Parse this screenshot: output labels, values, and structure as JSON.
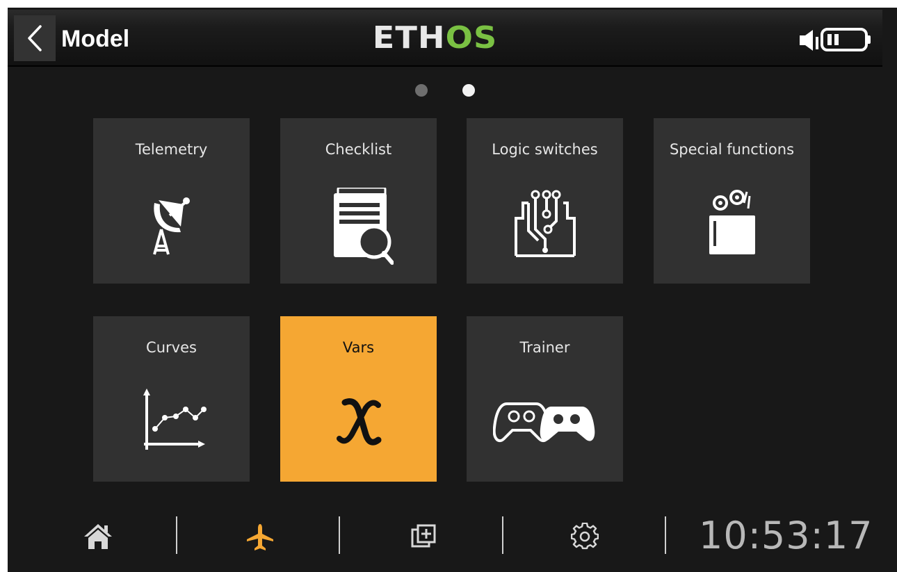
{
  "header": {
    "title": "Model",
    "brand": {
      "part1": "ETH",
      "part2": "OS"
    }
  },
  "pager": {
    "pages": 2,
    "current": 2
  },
  "tiles": [
    {
      "label": "Telemetry",
      "icon": "satellite-dish-icon",
      "selected": false
    },
    {
      "label": "Checklist",
      "icon": "checklist-search-icon",
      "selected": false
    },
    {
      "label": "Logic switches",
      "icon": "logic-circuit-icon",
      "selected": false
    },
    {
      "label": "Special functions",
      "icon": "gears-box-icon",
      "selected": false
    },
    {
      "label": "Curves",
      "icon": "line-graph-icon",
      "selected": false
    },
    {
      "label": "Vars",
      "icon": "variable-x-icon",
      "selected": true
    },
    {
      "label": "Trainer",
      "icon": "gamepads-icon",
      "selected": false
    }
  ],
  "bottom_nav": {
    "items": [
      "home-icon",
      "airplane-icon",
      "layers-add-icon",
      "gear-icon"
    ],
    "active": "airplane-icon",
    "clock": "10:53:17"
  },
  "colors": {
    "accent": "#f5a733",
    "brand_green": "#7ac143",
    "tile_bg": "#313131",
    "screen_bg": "#181818"
  }
}
